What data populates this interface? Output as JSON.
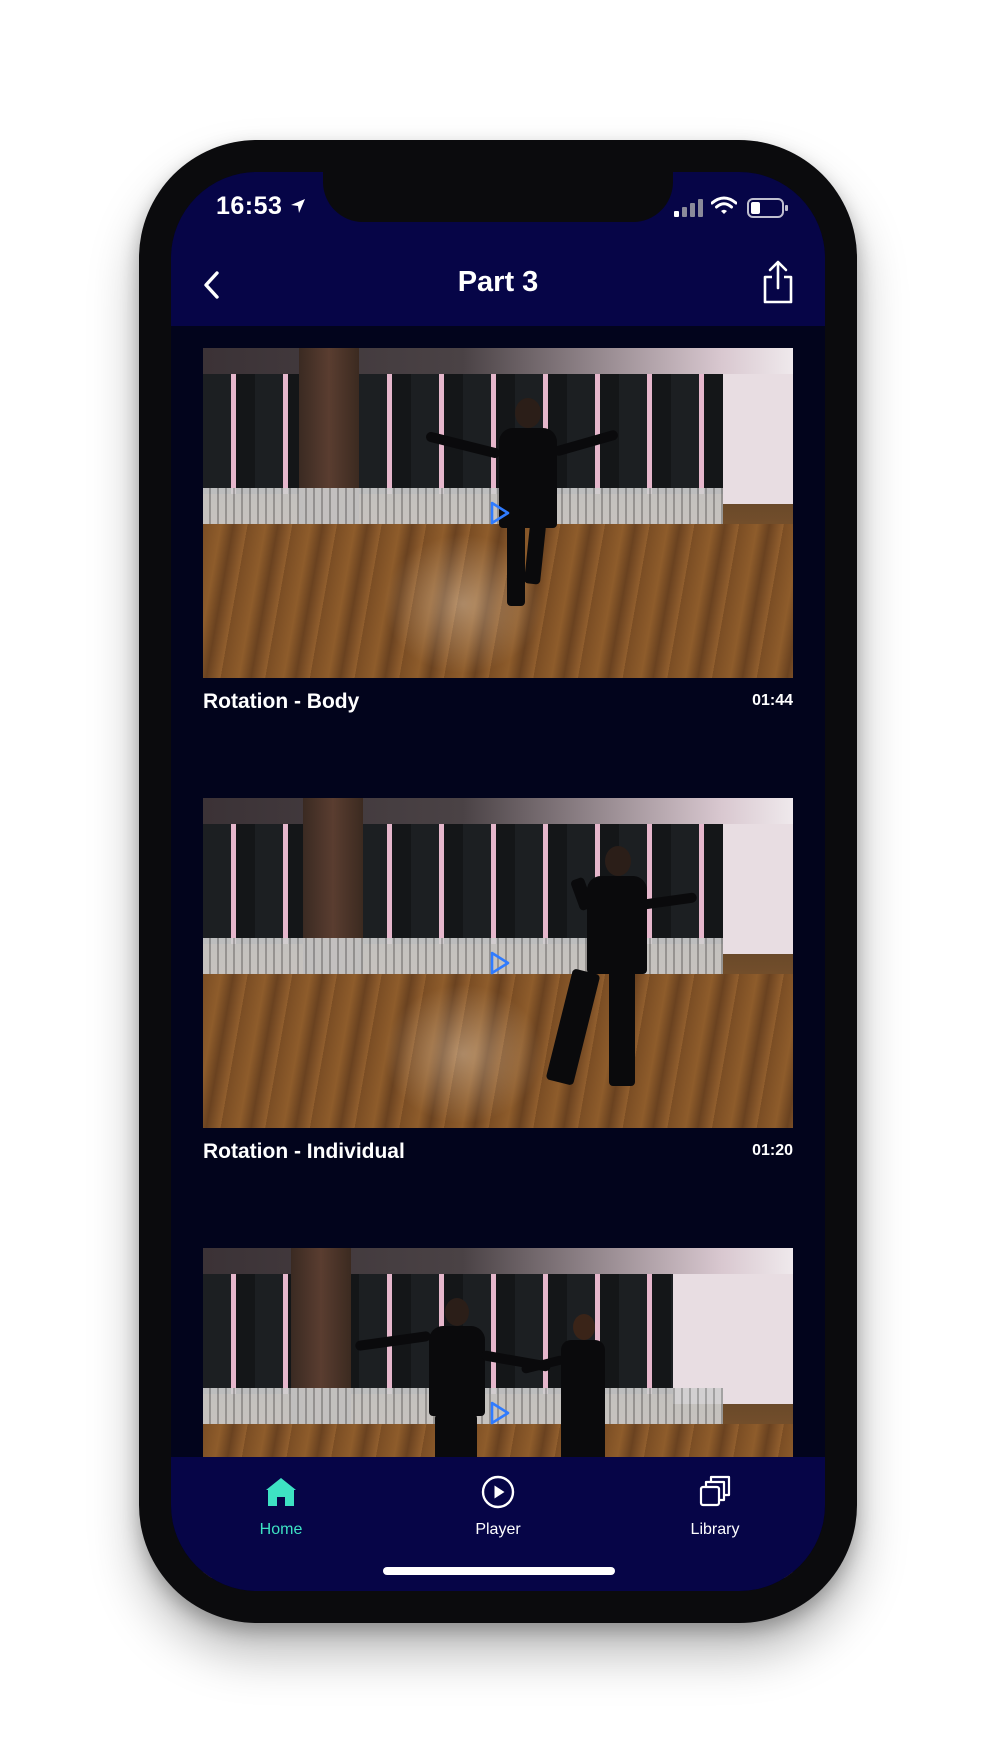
{
  "status_bar": {
    "time": "16:53"
  },
  "nav": {
    "title": "Part 3"
  },
  "videos": [
    {
      "title": "Rotation - Body",
      "duration": "01:44"
    },
    {
      "title": "Rotation - Individual",
      "duration": "01:20"
    },
    {
      "title": "",
      "duration": ""
    }
  ],
  "tabs": [
    {
      "label": "Home",
      "icon": "home-icon",
      "active": true
    },
    {
      "label": "Player",
      "icon": "play-circle-icon",
      "active": false
    },
    {
      "label": "Library",
      "icon": "library-icon",
      "active": false
    }
  ],
  "colors": {
    "nav_bg": "#060547",
    "content_bg": "#02041c",
    "active_tab": "#3ee2c3",
    "play_icon": "#2f7bff"
  }
}
